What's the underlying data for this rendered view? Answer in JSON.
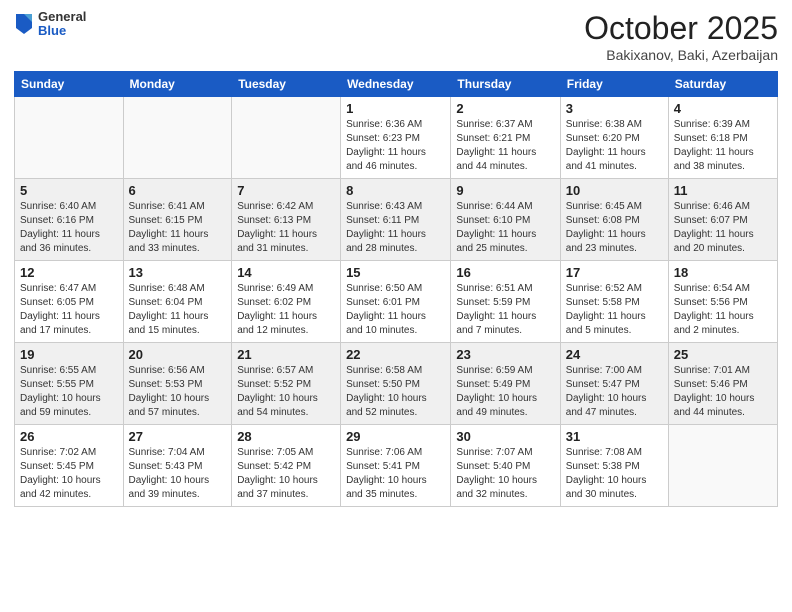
{
  "logo": {
    "general": "General",
    "blue": "Blue"
  },
  "header": {
    "month": "October 2025",
    "location": "Bakixanov, Baki, Azerbaijan"
  },
  "weekdays": [
    "Sunday",
    "Monday",
    "Tuesday",
    "Wednesday",
    "Thursday",
    "Friday",
    "Saturday"
  ],
  "weeks": [
    [
      {
        "day": "",
        "info": ""
      },
      {
        "day": "",
        "info": ""
      },
      {
        "day": "",
        "info": ""
      },
      {
        "day": "1",
        "info": "Sunrise: 6:36 AM\nSunset: 6:23 PM\nDaylight: 11 hours\nand 46 minutes."
      },
      {
        "day": "2",
        "info": "Sunrise: 6:37 AM\nSunset: 6:21 PM\nDaylight: 11 hours\nand 44 minutes."
      },
      {
        "day": "3",
        "info": "Sunrise: 6:38 AM\nSunset: 6:20 PM\nDaylight: 11 hours\nand 41 minutes."
      },
      {
        "day": "4",
        "info": "Sunrise: 6:39 AM\nSunset: 6:18 PM\nDaylight: 11 hours\nand 38 minutes."
      }
    ],
    [
      {
        "day": "5",
        "info": "Sunrise: 6:40 AM\nSunset: 6:16 PM\nDaylight: 11 hours\nand 36 minutes."
      },
      {
        "day": "6",
        "info": "Sunrise: 6:41 AM\nSunset: 6:15 PM\nDaylight: 11 hours\nand 33 minutes."
      },
      {
        "day": "7",
        "info": "Sunrise: 6:42 AM\nSunset: 6:13 PM\nDaylight: 11 hours\nand 31 minutes."
      },
      {
        "day": "8",
        "info": "Sunrise: 6:43 AM\nSunset: 6:11 PM\nDaylight: 11 hours\nand 28 minutes."
      },
      {
        "day": "9",
        "info": "Sunrise: 6:44 AM\nSunset: 6:10 PM\nDaylight: 11 hours\nand 25 minutes."
      },
      {
        "day": "10",
        "info": "Sunrise: 6:45 AM\nSunset: 6:08 PM\nDaylight: 11 hours\nand 23 minutes."
      },
      {
        "day": "11",
        "info": "Sunrise: 6:46 AM\nSunset: 6:07 PM\nDaylight: 11 hours\nand 20 minutes."
      }
    ],
    [
      {
        "day": "12",
        "info": "Sunrise: 6:47 AM\nSunset: 6:05 PM\nDaylight: 11 hours\nand 17 minutes."
      },
      {
        "day": "13",
        "info": "Sunrise: 6:48 AM\nSunset: 6:04 PM\nDaylight: 11 hours\nand 15 minutes."
      },
      {
        "day": "14",
        "info": "Sunrise: 6:49 AM\nSunset: 6:02 PM\nDaylight: 11 hours\nand 12 minutes."
      },
      {
        "day": "15",
        "info": "Sunrise: 6:50 AM\nSunset: 6:01 PM\nDaylight: 11 hours\nand 10 minutes."
      },
      {
        "day": "16",
        "info": "Sunrise: 6:51 AM\nSunset: 5:59 PM\nDaylight: 11 hours\nand 7 minutes."
      },
      {
        "day": "17",
        "info": "Sunrise: 6:52 AM\nSunset: 5:58 PM\nDaylight: 11 hours\nand 5 minutes."
      },
      {
        "day": "18",
        "info": "Sunrise: 6:54 AM\nSunset: 5:56 PM\nDaylight: 11 hours\nand 2 minutes."
      }
    ],
    [
      {
        "day": "19",
        "info": "Sunrise: 6:55 AM\nSunset: 5:55 PM\nDaylight: 10 hours\nand 59 minutes."
      },
      {
        "day": "20",
        "info": "Sunrise: 6:56 AM\nSunset: 5:53 PM\nDaylight: 10 hours\nand 57 minutes."
      },
      {
        "day": "21",
        "info": "Sunrise: 6:57 AM\nSunset: 5:52 PM\nDaylight: 10 hours\nand 54 minutes."
      },
      {
        "day": "22",
        "info": "Sunrise: 6:58 AM\nSunset: 5:50 PM\nDaylight: 10 hours\nand 52 minutes."
      },
      {
        "day": "23",
        "info": "Sunrise: 6:59 AM\nSunset: 5:49 PM\nDaylight: 10 hours\nand 49 minutes."
      },
      {
        "day": "24",
        "info": "Sunrise: 7:00 AM\nSunset: 5:47 PM\nDaylight: 10 hours\nand 47 minutes."
      },
      {
        "day": "25",
        "info": "Sunrise: 7:01 AM\nSunset: 5:46 PM\nDaylight: 10 hours\nand 44 minutes."
      }
    ],
    [
      {
        "day": "26",
        "info": "Sunrise: 7:02 AM\nSunset: 5:45 PM\nDaylight: 10 hours\nand 42 minutes."
      },
      {
        "day": "27",
        "info": "Sunrise: 7:04 AM\nSunset: 5:43 PM\nDaylight: 10 hours\nand 39 minutes."
      },
      {
        "day": "28",
        "info": "Sunrise: 7:05 AM\nSunset: 5:42 PM\nDaylight: 10 hours\nand 37 minutes."
      },
      {
        "day": "29",
        "info": "Sunrise: 7:06 AM\nSunset: 5:41 PM\nDaylight: 10 hours\nand 35 minutes."
      },
      {
        "day": "30",
        "info": "Sunrise: 7:07 AM\nSunset: 5:40 PM\nDaylight: 10 hours\nand 32 minutes."
      },
      {
        "day": "31",
        "info": "Sunrise: 7:08 AM\nSunset: 5:38 PM\nDaylight: 10 hours\nand 30 minutes."
      },
      {
        "day": "",
        "info": ""
      }
    ]
  ]
}
